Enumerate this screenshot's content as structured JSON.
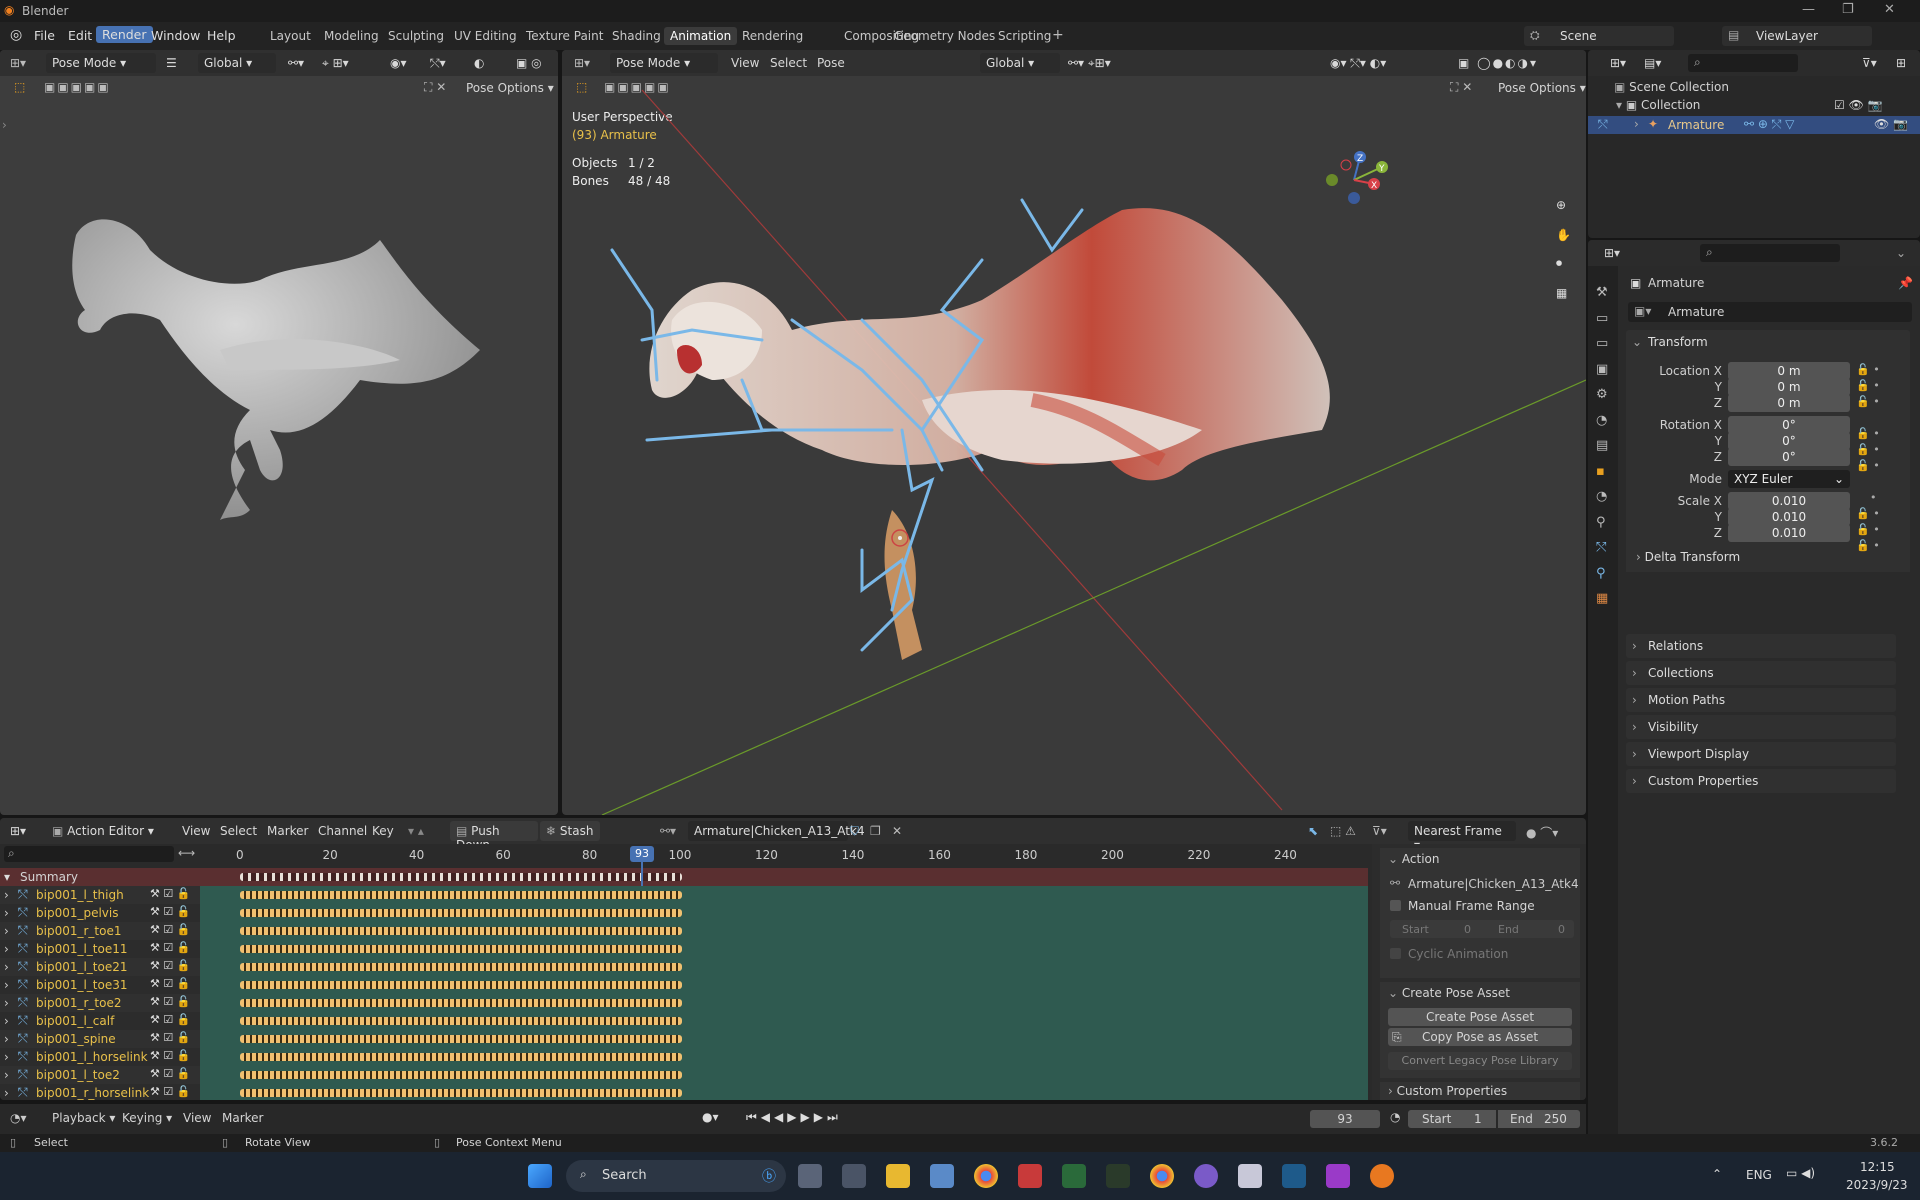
{
  "window": {
    "title": "Blender"
  },
  "menu": {
    "file": "File",
    "edit": "Edit",
    "render": "Render",
    "window": "Window",
    "help": "Help"
  },
  "workspaces": [
    "Layout",
    "Modeling",
    "Sculpting",
    "UV Editing",
    "Texture Paint",
    "Shading",
    "Animation",
    "Rendering",
    "Compositing",
    "Geometry Nodes",
    "Scripting"
  ],
  "active_workspace": "Animation",
  "scene": {
    "name": "Scene",
    "view_layer": "ViewLayer"
  },
  "left_viewport": {
    "mode": "Pose Mode",
    "orientation": "Global",
    "pose_options": "Pose Options"
  },
  "right_viewport": {
    "mode": "Pose Mode",
    "menus": [
      "View",
      "Select",
      "Pose"
    ],
    "orientation": "Global",
    "pose_options": "Pose Options",
    "perspective": "User Perspective",
    "object_name": "(93) Armature",
    "objects_label": "Objects",
    "objects_value": "1 / 2",
    "bones_label": "Bones",
    "bones_value": "48 / 48",
    "axes": {
      "x": "X",
      "y": "Y",
      "z": "Z"
    }
  },
  "outliner": {
    "scene_collection": "Scene Collection",
    "collection": "Collection",
    "armature": "Armature"
  },
  "properties": {
    "object_name": "Armature",
    "object_field": "Armature",
    "transform_title": "Transform",
    "location_label": "Location X",
    "location": [
      "0 m",
      "0 m",
      "0 m"
    ],
    "rotation_label": "Rotation X",
    "rotation": [
      "0°",
      "0°",
      "0°"
    ],
    "mode_label": "Mode",
    "mode_value": "XYZ Euler",
    "scale_label": "Scale X",
    "scale": [
      "0.010",
      "0.010",
      "0.010"
    ],
    "y": "Y",
    "z": "Z",
    "panels": [
      "Delta Transform",
      "Relations",
      "Collections",
      "Motion Paths",
      "Visibility",
      "Viewport Display",
      "Custom Properties"
    ]
  },
  "action_editor": {
    "editor_type": "Action Editor",
    "menus": [
      "View",
      "Select",
      "Marker",
      "Channel",
      "Key"
    ],
    "push_down": "Push Down",
    "stash": "Stash",
    "action_name": "Armature|Chicken_A13_Atk4",
    "snapping": "Nearest Frame",
    "ruler": [
      "0",
      "20",
      "40",
      "60",
      "80",
      "100",
      "120",
      "140",
      "160",
      "180",
      "200",
      "220",
      "240"
    ],
    "current_frame": "93",
    "summary": "Summary",
    "channels": [
      "bip001_l_thigh",
      "bip001_pelvis",
      "bip001_r_toe1",
      "bip001_l_toe11",
      "bip001_l_toe21",
      "bip001_l_toe31",
      "bip001_r_toe2",
      "bip001_l_calf",
      "bip001_spine",
      "bip001_l_horselink",
      "bip001_l_toe2",
      "bip001_r_horselink"
    ],
    "sidebar": {
      "action_title": "Action",
      "action_name": "Armature|Chicken_A13_Atk4",
      "manual_range": "Manual Frame Range",
      "start_label": "Start",
      "start_value": "0",
      "end_label": "End",
      "end_value": "0",
      "cyclic": "Cyclic Animation",
      "pose_asset_title": "Create Pose Asset",
      "create_pose_asset": "Create Pose Asset",
      "copy_pose_asset": "Copy Pose as Asset",
      "convert_legacy": "Convert Legacy Pose Library",
      "custom_props": "Custom Properties"
    }
  },
  "timeline": {
    "playback": "Playback",
    "keying": "Keying",
    "view": "View",
    "marker": "Marker",
    "frame": "93",
    "start_label": "Start",
    "start": "1",
    "end_label": "End",
    "end": "250"
  },
  "status": {
    "select": "Select",
    "rotate": "Rotate View",
    "context": "Pose Context Menu",
    "version": "3.6.2"
  },
  "taskbar": {
    "search": "Search",
    "lang": "ENG",
    "time": "12:15",
    "date": "2023/9/23"
  }
}
